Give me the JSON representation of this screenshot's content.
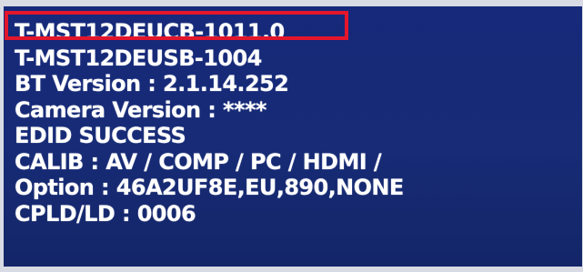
{
  "info_lines": [
    "T-MST12DEUCB-1011.0",
    "T-MST12DEUSB-1004",
    "BT Version : 2.1.14.252",
    "Camera Version : ****",
    "EDID SUCCESS",
    "CALIB : AV / COMP / PC / HDMI /",
    "Option : 46A2UF8E,EU,890,NONE",
    "CPLD/LD : 0006"
  ],
  "highlight_color": "#e3162b",
  "screen_color": "#162a78",
  "text_color": "#ffffff"
}
